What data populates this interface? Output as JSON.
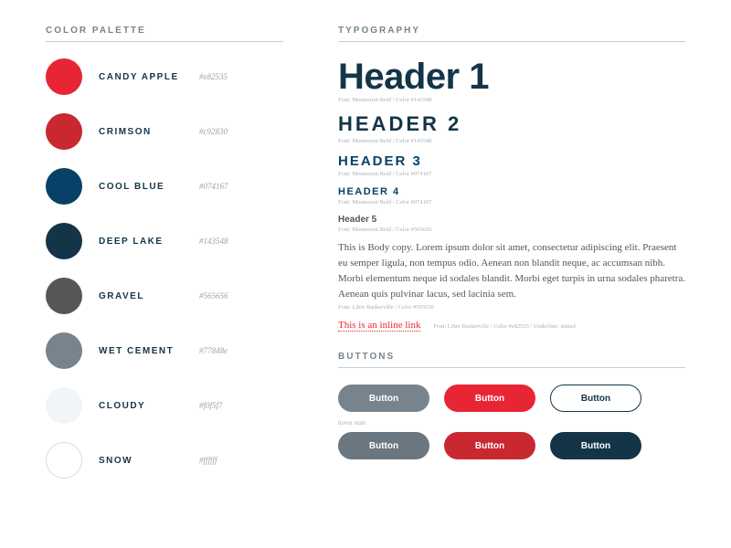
{
  "palette": {
    "title": "COLOR PALETTE",
    "items": [
      {
        "name": "CANDY APPLE",
        "hex": "#e82535"
      },
      {
        "name": "CRIMSON",
        "hex": "#c92830"
      },
      {
        "name": "COOL BLUE",
        "hex": "#074167"
      },
      {
        "name": "DEEP LAKE",
        "hex": "#143548"
      },
      {
        "name": "GRAVEL",
        "hex": "#565656"
      },
      {
        "name": "WET CEMENT",
        "hex": "#77848e"
      },
      {
        "name": "CLOUDY",
        "hex": "#f0f5f7"
      },
      {
        "name": "SNOW",
        "hex": "#ffffff"
      }
    ]
  },
  "typography": {
    "title": "TYPOGRAPHY",
    "h1": {
      "text": "Header 1",
      "meta": "Font: Montserrat Bold / Color #143548"
    },
    "h2": {
      "text": "HEADER 2",
      "meta": "Font: Montserrat Bold / Color #143548"
    },
    "h3": {
      "text": "HEADER 3",
      "meta": "Font: Montserrat Bold / Color #074167"
    },
    "h4": {
      "text": "HEADER 4",
      "meta": "Font: Montserrat Bold / Color #074167"
    },
    "h5": {
      "text": "Header 5",
      "meta": "Font: Montserrat Bold / Color #565656"
    },
    "body": "This is Body copy. Lorem ipsum dolor sit amet, consectetur adipiscing elit. Praesent eu semper ligula, non tempus odio. Aenean non blandit neque, ac accumsan nibh. Morbi elementum neque id sodales blandit. Morbi eget turpis in urna sodales pharetra. Aenean quis pulvinar lacus, sed lacinia sem.",
    "body_meta": "Font: Libre Baskerville / Color #565656",
    "link": "This is an inline link",
    "link_meta": "Font: Libre Baskerville / Color #e82535 / Underline: dotted"
  },
  "buttons": {
    "title": "BUTTONS",
    "hover_label": "hover state",
    "row1": [
      "Button",
      "Button",
      "Button"
    ],
    "row2": [
      "Button",
      "Button",
      "Button"
    ]
  }
}
